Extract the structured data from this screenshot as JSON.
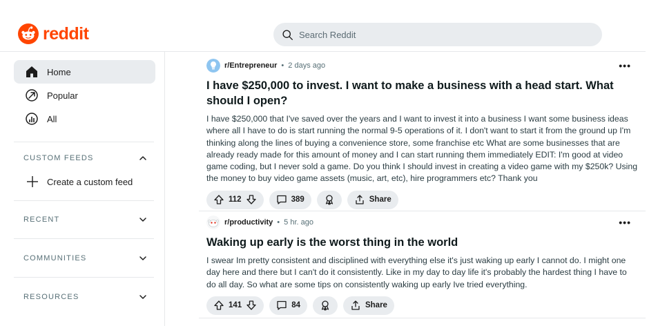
{
  "app": {
    "brand": "reddit",
    "brand_color": "#ff4500"
  },
  "search": {
    "placeholder": "Search Reddit"
  },
  "sidebar": {
    "nav": [
      {
        "label": "Home",
        "icon": "home-icon",
        "active": true
      },
      {
        "label": "Popular",
        "icon": "popular-icon"
      },
      {
        "label": "All",
        "icon": "all-icon"
      }
    ],
    "custom_feeds": {
      "heading": "CUSTOM FEEDS",
      "create_label": "Create a custom feed"
    },
    "recent": {
      "heading": "RECENT"
    },
    "communities": {
      "heading": "COMMUNITIES"
    },
    "resources": {
      "heading": "RESOURCES"
    }
  },
  "posts": [
    {
      "subreddit": "r/Entrepreneur",
      "separator": "•",
      "time": "2 days ago",
      "title": "I have $250,000 to invest. I want to make a business with a head start. What should I open?",
      "body": "I have $250,000 that I've saved over the years and I want to invest it into a business I want some business ideas where all I have to do is start running the normal 9-5 operations of it. I don't want to start it from the ground up I'm thinking along the lines of buying a convenience store, some franchise etc What are some businesses that are already ready made for this amount of money and I can start running them immediately EDIT: I'm good at video game coding, but I never sold a game. Do you think I should invest in creating a video game with my $250k? Using the money to buy video game assets (music, art, etc), hire programmers etc? Thank you",
      "votes": "112",
      "comments": "389",
      "share_label": "Share"
    },
    {
      "subreddit": "r/productivity",
      "separator": "•",
      "time": "5 hr. ago",
      "title": "Waking up early is the worst thing in the world",
      "body": "I swear Im pretty consistent and disciplined with everything else it's just waking up early I cannot do. I might one day here and there but I can't do it consistently. Like in my day to day life it's probably the hardest thing I have to do all day. So what are some tips on consistently waking up early Ive tried everything.",
      "votes": "141",
      "comments": "84",
      "share_label": "Share"
    }
  ]
}
